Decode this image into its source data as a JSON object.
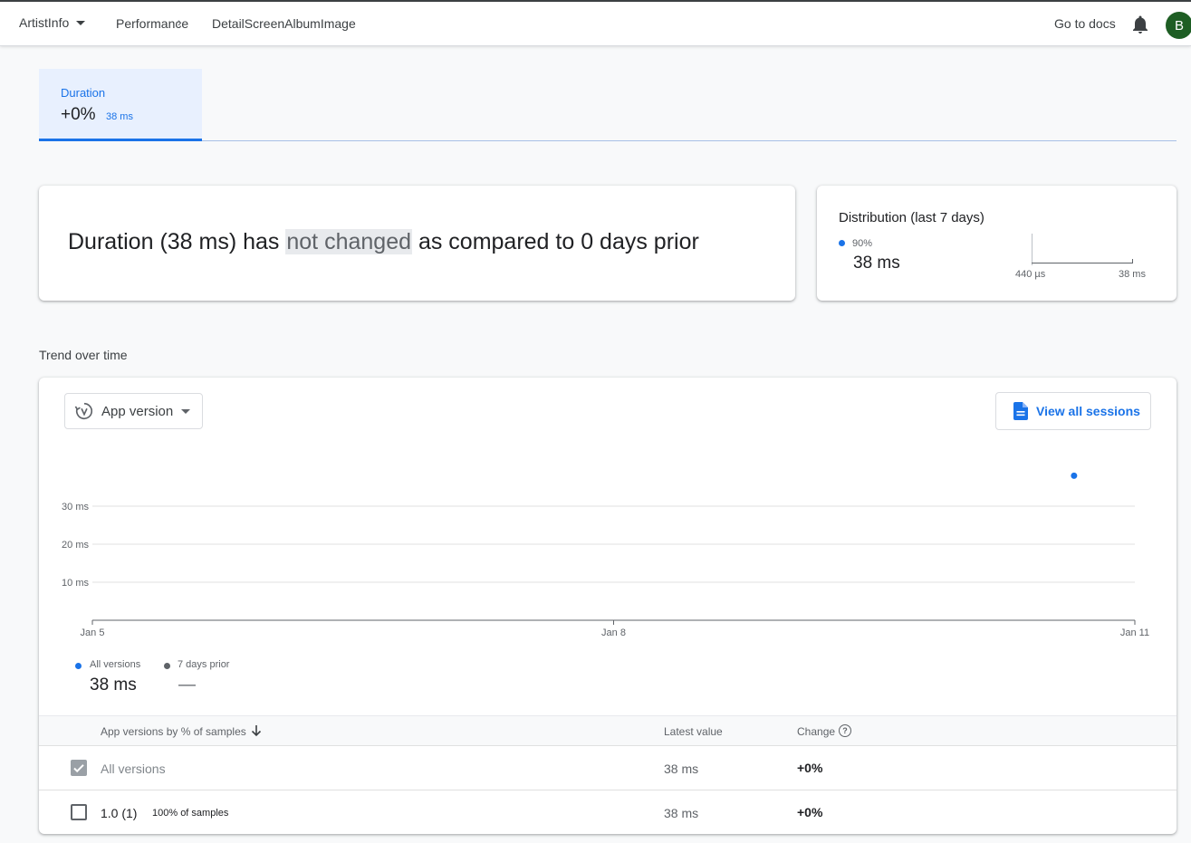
{
  "header": {
    "app_name": "ArtistInfo",
    "breadcrumb": [
      "Performance",
      "DetailScreenAlbumImage"
    ],
    "breadcrumb_separator": "›",
    "docs_link": "Go to docs",
    "avatar_letter": "B"
  },
  "metric_tab": {
    "label": "Duration",
    "change": "+0%",
    "value": "38 ms"
  },
  "summary": {
    "prefix": "Duration (38 ms) has ",
    "highlight": "not changed",
    "suffix": " as compared to 0 days prior"
  },
  "distribution": {
    "title": "Distribution (last 7 days)",
    "percentile": "90%",
    "value": "38 ms",
    "axis_min": "440 µs",
    "axis_max": "38 ms"
  },
  "trend": {
    "section_title": "Trend over time",
    "group_select": "App version",
    "view_sessions": "View all sessions",
    "legend": [
      {
        "name": "All versions",
        "value": "38 ms",
        "color": "#1a73e8"
      },
      {
        "name": "7 days prior",
        "value": "—",
        "color": "#5f6368"
      }
    ]
  },
  "chart_data": {
    "type": "scatter",
    "x_ticks": [
      "Jan 5",
      "Jan 8",
      "Jan 11"
    ],
    "y_ticks": [
      "10 ms",
      "20 ms",
      "30 ms"
    ],
    "ylim": [
      0,
      30
    ],
    "grid": true,
    "series": [
      {
        "name": "All versions",
        "color": "#1a73e8",
        "points": [
          {
            "x": "Jan 10",
            "y": 38
          }
        ]
      }
    ]
  },
  "table": {
    "columns": [
      "App versions by % of samples",
      "Latest value",
      "Change"
    ],
    "rows": [
      {
        "name": "All versions",
        "samples": "",
        "latest": "38 ms",
        "change": "+0%",
        "checked": true
      },
      {
        "name": "1.0 (1)",
        "samples": "100% of samples",
        "latest": "38 ms",
        "change": "+0%",
        "checked": false
      }
    ]
  },
  "colors": {
    "accent": "#1a73e8",
    "avatar": "#1e5e24"
  },
  "icons": {
    "app_caret": "caret-down-icon",
    "bell": "bell-icon",
    "version": "version-history-icon",
    "sessions": "document-icon",
    "sort": "arrow-down-icon",
    "help": "help-circle-icon",
    "check": "check-icon"
  }
}
